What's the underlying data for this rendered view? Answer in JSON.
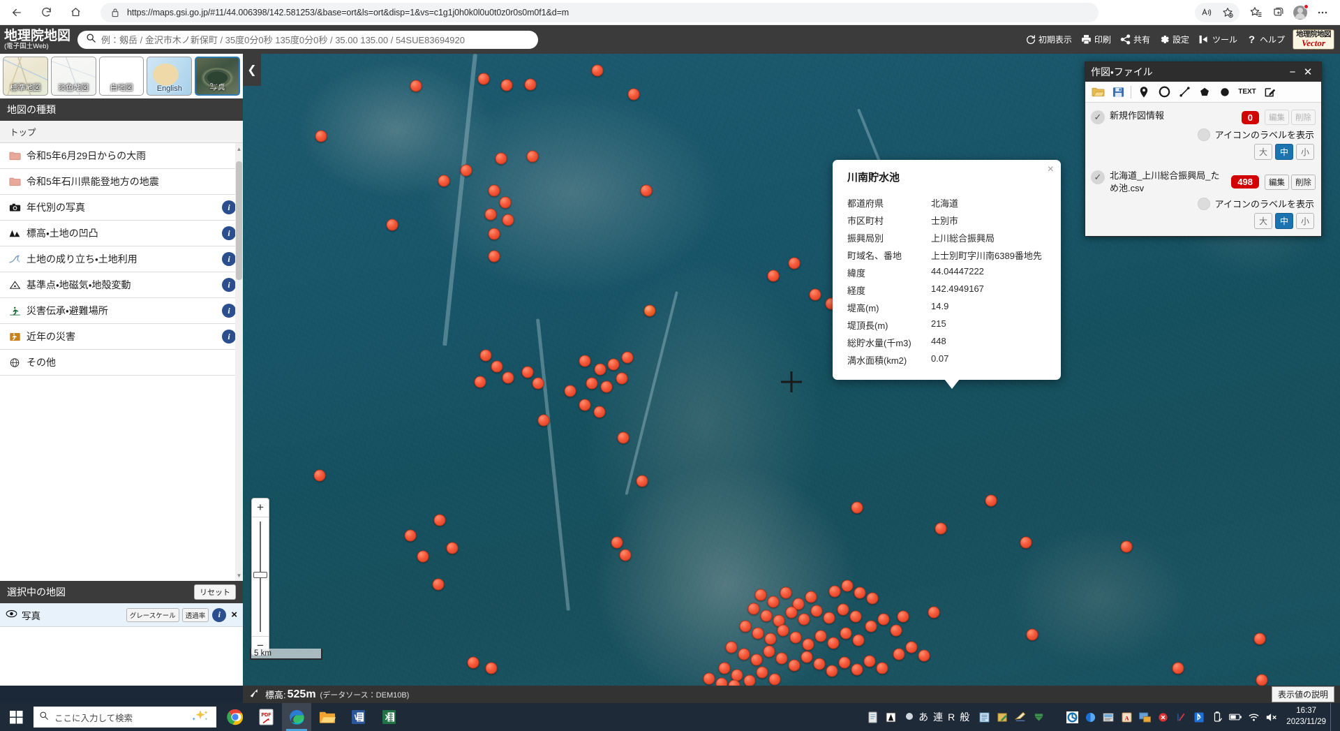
{
  "browser": {
    "url": "https://maps.gsi.go.jp/#11/44.006398/142.581253/&base=ort&ls=ort&disp=1&vs=c1g1j0h0k0l0u0t0z0r0s0m0f1&d=m",
    "back_label": "戻る",
    "refresh_label": "更新",
    "home_label": "ホーム",
    "read_aloud_label": "音声で読み上げる",
    "add_favorite_label": "お気に入りに追加",
    "favorites_label": "お気に入り",
    "collections_label": "コレクション",
    "profile_label": "プロフィール",
    "settings_label": "設定など"
  },
  "gsi_header": {
    "logo_line1": "地理院地図",
    "logo_line2": "(電子国土Web)",
    "search_placeholder": "例：剱岳 / 金沢市木ノ新保町 / 35度0分0秒 135度0分0秒 / 35.00 135.00 / 54SUE83694920",
    "search_value": "",
    "tools": [
      {
        "name": "initial-view",
        "label": "初期表示",
        "icon": "refresh-icon"
      },
      {
        "name": "print",
        "label": "印刷",
        "icon": "printer-icon"
      },
      {
        "name": "share",
        "label": "共有",
        "icon": "share-icon"
      },
      {
        "name": "settings",
        "label": "設定",
        "icon": "gear-icon"
      },
      {
        "name": "tools",
        "label": "ツール",
        "icon": "ruler-icon"
      },
      {
        "name": "help",
        "label": "ヘルプ",
        "icon": "question-icon"
      }
    ],
    "vector_badge_line1": "地理院地図",
    "vector_badge_line2": "Vector"
  },
  "sidebar": {
    "basemaps": [
      {
        "label": "標準地図",
        "selected": false
      },
      {
        "label": "淡色地図",
        "selected": false
      },
      {
        "label": "白地図",
        "selected": false
      },
      {
        "label": "English",
        "selected": false
      },
      {
        "label": "写真",
        "selected": true
      }
    ],
    "section_title": "地図の種類",
    "top_label": "トップ",
    "items": [
      {
        "label": "令和5年6月29日からの大雨",
        "icon": "folder-icon",
        "info": false
      },
      {
        "label": "令和5年石川県能登地方の地震",
        "icon": "folder-icon",
        "info": false
      },
      {
        "label": "年代別の写真",
        "icon": "camera-icon",
        "info": true
      },
      {
        "label": "標高・土地の凹凸",
        "icon": "mountain-icon",
        "info": true
      },
      {
        "label": "土地の成り立ち・土地利用",
        "icon": "landform-icon",
        "info": true
      },
      {
        "label": "基準点・地磁気・地殻変動",
        "icon": "triangle-point-icon",
        "info": true
      },
      {
        "label": "災害伝承・避難場所",
        "icon": "evacuation-icon",
        "info": true
      },
      {
        "label": "近年の災害",
        "icon": "disaster-icon",
        "info": true
      },
      {
        "label": "その他",
        "icon": "globe-icon",
        "info": false
      }
    ],
    "selected_map": {
      "title": "選択中の地図",
      "reset_label": "リセット",
      "layer_name": "写真",
      "grayscale_label": "グレースケール",
      "opacity_label": "透過率",
      "info_label": "i",
      "remove_label": "×"
    }
  },
  "map": {
    "collapse_label": "❮",
    "scale_label": "5 km",
    "zoom_in_label": "+",
    "zoom_out_label": "−",
    "crosshair_name": "map-center-crosshair"
  },
  "popup": {
    "title": "川南貯水池",
    "close_label": "×",
    "rows": [
      {
        "key": "都道府県",
        "value": "北海道"
      },
      {
        "key": "市区町村",
        "value": "士別市"
      },
      {
        "key": "振興局別",
        "value": "上川総合振興局"
      },
      {
        "key": "町域名、番地",
        "value": "上士別町字川南6389番地先"
      },
      {
        "key": "緯度",
        "value": "44.04447222"
      },
      {
        "key": "経度",
        "value": "142.4949167"
      },
      {
        "key": "堤高(m)",
        "value": "14.9"
      },
      {
        "key": "堤頂長(m)",
        "value": "215"
      },
      {
        "key": "総貯水量(千m3)",
        "value": "448"
      },
      {
        "key": "満水面積(km2)",
        "value": "0.07"
      }
    ]
  },
  "draw_panel": {
    "title": "作図・ファイル",
    "minimize_label": "−",
    "close_label": "✕",
    "tools": [
      {
        "name": "open-file-icon",
        "title": "ファイルを開く"
      },
      {
        "name": "save-file-icon",
        "title": "保存"
      },
      {
        "name": "marker-icon",
        "title": "マーカー"
      },
      {
        "name": "circle-icon",
        "title": "円"
      },
      {
        "name": "line-icon",
        "title": "線"
      },
      {
        "name": "polygon-icon",
        "title": "多角形"
      },
      {
        "name": "filled-circle-icon",
        "title": "塗り円"
      },
      {
        "name": "text-icon",
        "title": "TEXT",
        "label": "TEXT"
      },
      {
        "name": "edit-icon",
        "title": "編集"
      }
    ],
    "layers": [
      {
        "name": "新規作図情報",
        "count": "0",
        "edit_label": "編集",
        "delete_label": "削除",
        "buttons_disabled": true,
        "label_toggle": "アイコンのラベルを表示",
        "sizes": [
          "大",
          "中",
          "小"
        ],
        "active_size": "中"
      },
      {
        "name": "北海道_上川総合振興局_ため池.csv",
        "count": "498",
        "edit_label": "編集",
        "delete_label": "削除",
        "buttons_disabled": false,
        "label_toggle": "アイコンのラベルを表示",
        "sizes": [
          "大",
          "中",
          "小"
        ],
        "active_size": "中"
      }
    ]
  },
  "status_bar": {
    "elevation_label": "標高:",
    "elevation_value": "525m",
    "data_source": "(データソース：DEM10B)",
    "explain_label": "表示値の説明"
  },
  "taskbar": {
    "search_placeholder": "ここに入力して検索",
    "apps": [
      {
        "name": "chrome-icon",
        "label": "Google Chrome",
        "active": false
      },
      {
        "name": "pdf-icon",
        "label": "PDF",
        "active": false
      },
      {
        "name": "edge-icon",
        "label": "Microsoft Edge",
        "active": true
      },
      {
        "name": "explorer-icon",
        "label": "エクスプローラー",
        "active": false
      },
      {
        "name": "word-icon",
        "label": "Word",
        "active": false
      },
      {
        "name": "excel-icon",
        "label": "Excel",
        "active": false
      }
    ],
    "ime": [
      "あ",
      "連",
      "R",
      "般"
    ],
    "time": "16:37",
    "date": "2023/11/29"
  },
  "colors": {
    "accent_blue": "#1b74b0",
    "count_red": "#d30000",
    "marker_red": "#f4593a",
    "header_dark": "#3b3b3b",
    "taskbar": "#1f2a38"
  }
}
